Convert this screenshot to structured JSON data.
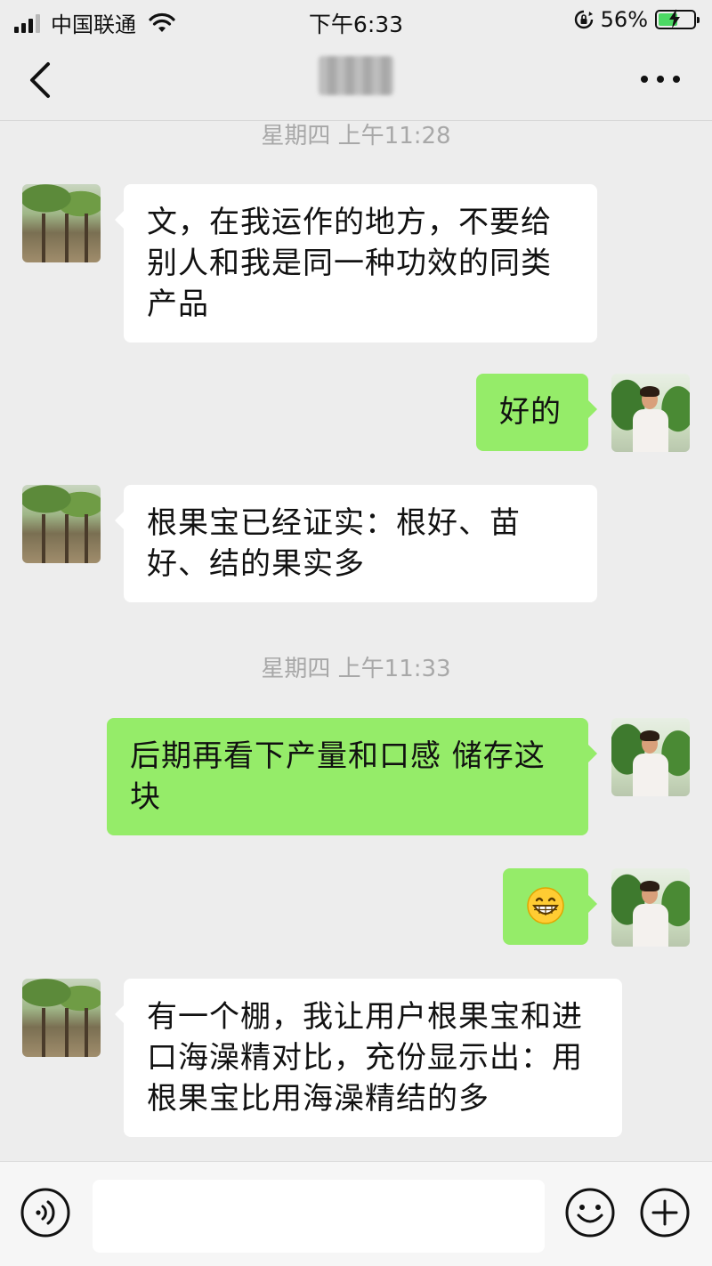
{
  "status_bar": {
    "carrier": "中国联通",
    "time": "下午6:33",
    "battery_percent": "56%",
    "battery_level": 0.56,
    "icons": [
      "signal-icon",
      "wifi-icon",
      "orientation-lock-icon",
      "battery-charging-icon"
    ]
  },
  "nav": {
    "back_icon": "chevron-left-icon",
    "title": "",
    "more_icon": "more-dots-icon"
  },
  "messages": [
    {
      "type": "timestamp",
      "text": "星期四 上午11:28"
    },
    {
      "type": "incoming",
      "text": "文，在我运作的地方，不要给别人和我是同一种功效的同类产品"
    },
    {
      "type": "outgoing",
      "text": "好的"
    },
    {
      "type": "incoming",
      "text": "根果宝已经证实：根好、苗好、结的果实多"
    },
    {
      "type": "timestamp",
      "text": "星期四 上午11:33"
    },
    {
      "type": "outgoing",
      "text": "后期再看下产量和口感 储存这块"
    },
    {
      "type": "outgoing",
      "emoji": "grinning-face"
    },
    {
      "type": "incoming",
      "text": "有一个棚，我让用户根果宝和进口海澡精对比，充份显示出：用根果宝比用海澡精结的多"
    }
  ],
  "input_bar": {
    "voice_icon": "voice-icon",
    "input_value": "",
    "emoji_icon": "emoji-icon",
    "plus_icon": "plus-icon"
  },
  "colors": {
    "background": "#ededed",
    "outgoing_bubble": "#95ec69",
    "incoming_bubble": "#ffffff",
    "timestamp_text": "#a8a8a8"
  }
}
